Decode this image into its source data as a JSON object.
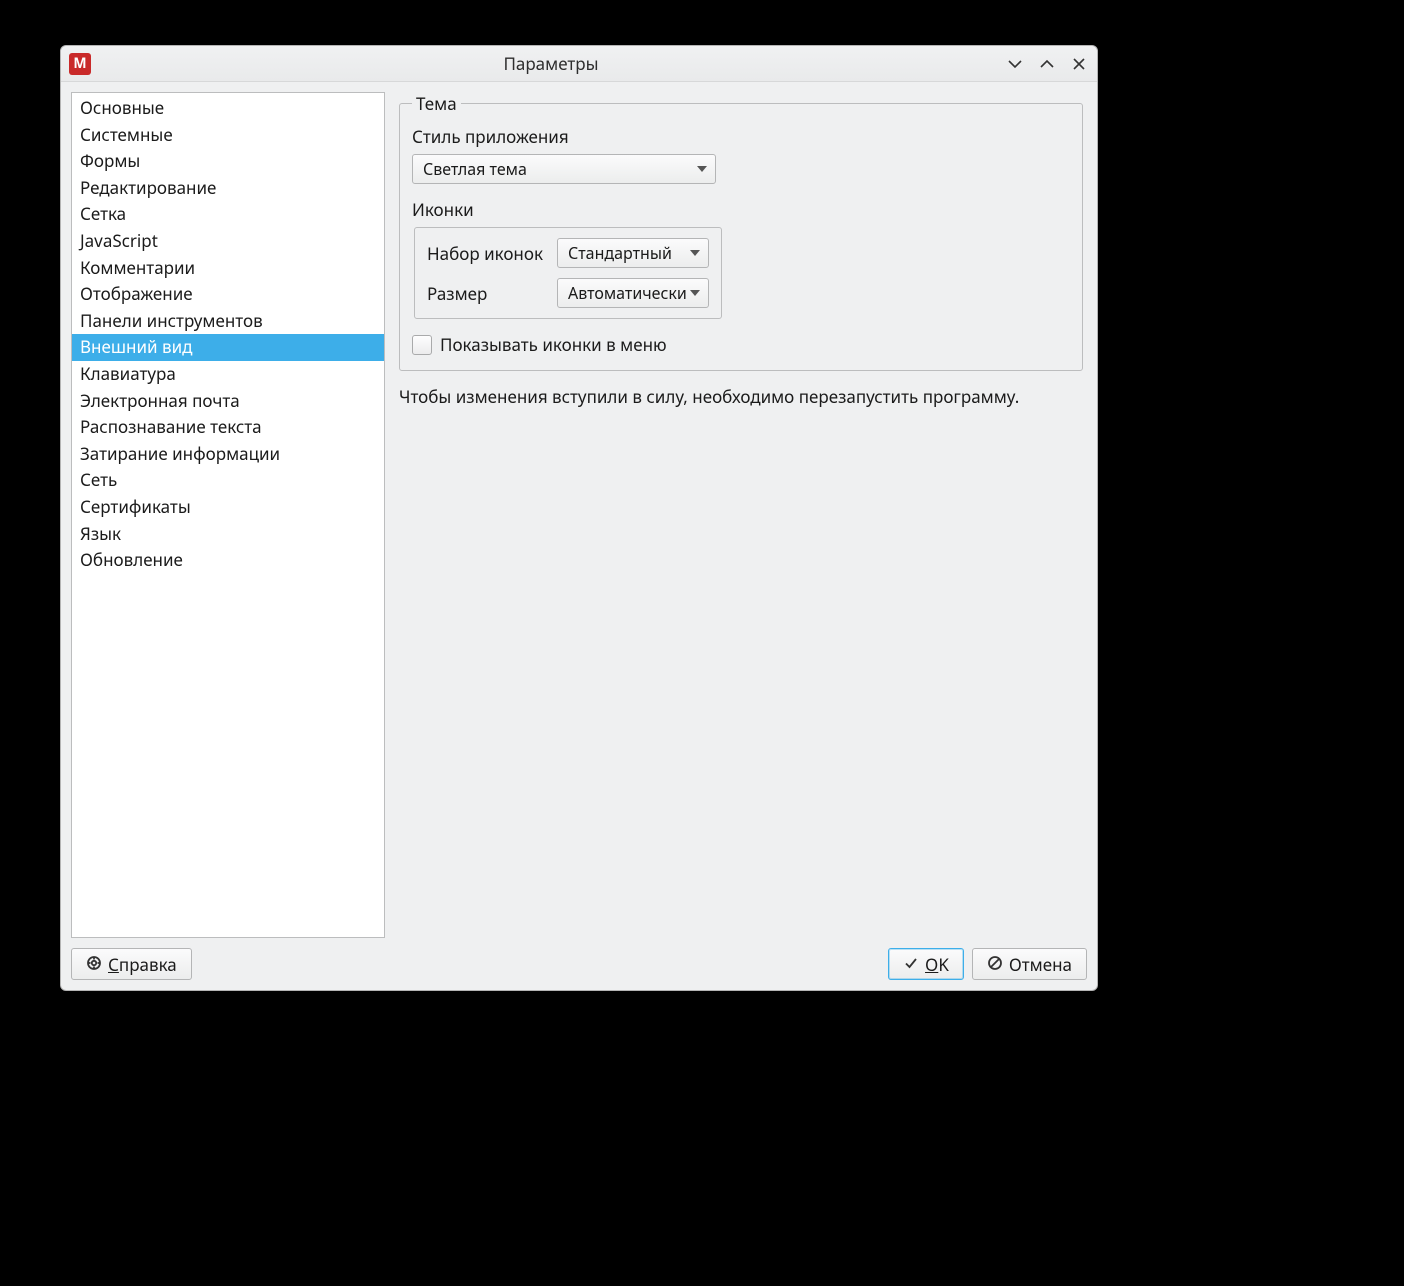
{
  "window": {
    "title": "Параметры"
  },
  "sidebar": {
    "items": [
      "Основные",
      "Системные",
      "Формы",
      "Редактирование",
      "Сетка",
      "JavaScript",
      "Комментарии",
      "Отображение",
      "Панели инструментов",
      "Внешний вид",
      "Клавиатура",
      "Электронная почта",
      "Распознавание текста",
      "Затирание информации",
      "Сеть",
      "Сертификаты",
      "Язык",
      "Обновление"
    ],
    "selected_index": 9
  },
  "theme_group": {
    "legend": "Тема",
    "app_style_label": "Стиль приложения",
    "app_style_value": "Светлая тема",
    "icons_label": "Иконки",
    "icon_set_label": "Набор иконок",
    "icon_set_value": "Стандартный",
    "icon_size_label": "Размер",
    "icon_size_value": "Автоматически",
    "show_icons_in_menu_label": "Показывать иконки в меню",
    "show_icons_in_menu_checked": false
  },
  "hint": "Чтобы изменения вступили в силу, необходимо перезапустить программу.",
  "buttons": {
    "help": "Справка",
    "ok": "OK",
    "cancel": "Отмена"
  }
}
